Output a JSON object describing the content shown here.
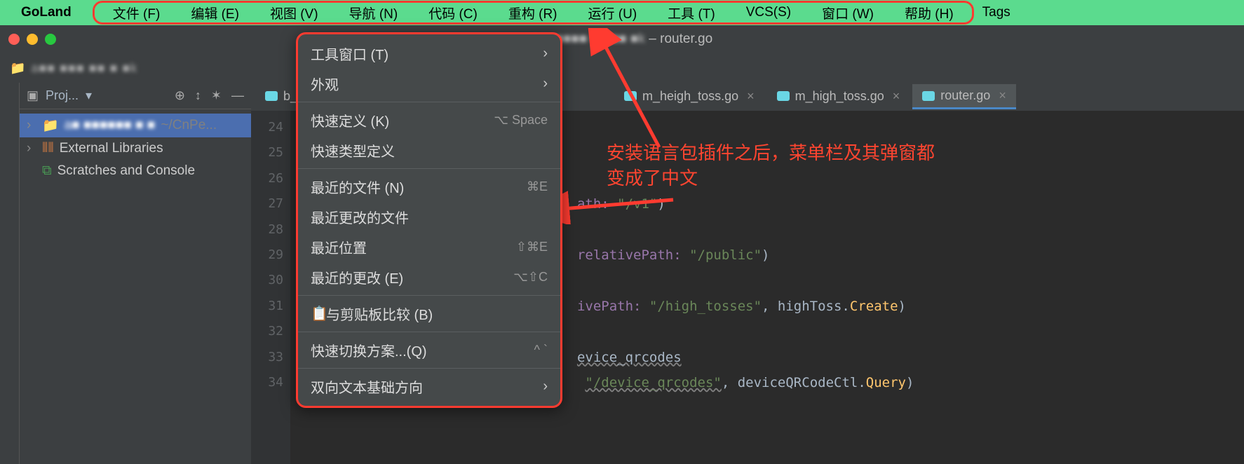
{
  "menubar": {
    "app_name": "GoLand",
    "items": [
      "文件 (F)",
      "编辑 (E)",
      "视图 (V)",
      "导航 (N)",
      "代码 (C)",
      "重构 (R)",
      "运行 (U)",
      "工具 (T)",
      "VCS(S)",
      "窗口 (W)",
      "帮助 (H)"
    ],
    "tags": "Tags"
  },
  "window": {
    "title": " – router.go",
    "title_prefix_blur": "a■■■■■■ ■■ ■■ ■k"
  },
  "breadcrumb": {
    "text_blur": "a■■ ■■■ ■■ ■ ■k"
  },
  "project": {
    "header": "Proj...",
    "root_blur": "a■ ■■■■■■ ■ ■",
    "root_path": "~/CnPe...",
    "ext_libs": "External Libraries",
    "scratches": "Scratches and Console"
  },
  "tabs": [
    {
      "label": "b_",
      "active": false
    },
    {
      "label": "m_heigh_toss.go",
      "active": false,
      "closable": true
    },
    {
      "label": "m_high_toss.go",
      "active": false,
      "closable": true
    },
    {
      "label": "router.go",
      "active": true,
      "closable": true
    }
  ],
  "gutter": {
    "lines": [
      "24",
      "25",
      "26",
      "27",
      "28",
      "29",
      "30",
      "31",
      "32",
      "33",
      "34"
    ]
  },
  "code": {
    "l27": {
      "a": "ath: ",
      "b": "\"/v1\"",
      "c": ")"
    },
    "l29": {
      "a": "relativePath: ",
      "b": "\"/public\"",
      "c": ")"
    },
    "l31": {
      "a": "ivePath: ",
      "b": "\"/high_tosses\"",
      "c": ", highToss.",
      "d": "Create",
      "e": ")"
    },
    "l33": {
      "a": "evice_qrcodes"
    },
    "l34": {
      "a": " ",
      "b": "\"/device_qrcodes\"",
      "c": ", deviceQRCodeCtl.",
      "d": "Query",
      "e": ")"
    }
  },
  "view_menu": {
    "items": [
      {
        "label": "工具窗口 (T)",
        "sub": true
      },
      {
        "label": "外观",
        "sub": true
      },
      {
        "sep": true
      },
      {
        "label": "快速定义 (K)",
        "shortcut": "⌥ Space"
      },
      {
        "label": "快速类型定义"
      },
      {
        "sep": true
      },
      {
        "label": "最近的文件 (N)",
        "shortcut": "⌘E"
      },
      {
        "label": "最近更改的文件"
      },
      {
        "label": "最近位置",
        "shortcut": "⇧⌘E"
      },
      {
        "label": "最近的更改 (E)",
        "shortcut": "⌥⇧C"
      },
      {
        "sep": true
      },
      {
        "label": "与剪贴板比较 (B)",
        "icon": true
      },
      {
        "sep": true
      },
      {
        "label": "快速切换方案...(Q)",
        "shortcut": "^ `"
      },
      {
        "sep": true
      },
      {
        "label": "双向文本基础方向",
        "sub": true
      }
    ]
  },
  "annotation": {
    "line1": "安装语言包插件之后，菜单栏及其弹窗都",
    "line2": "变成了中文"
  }
}
